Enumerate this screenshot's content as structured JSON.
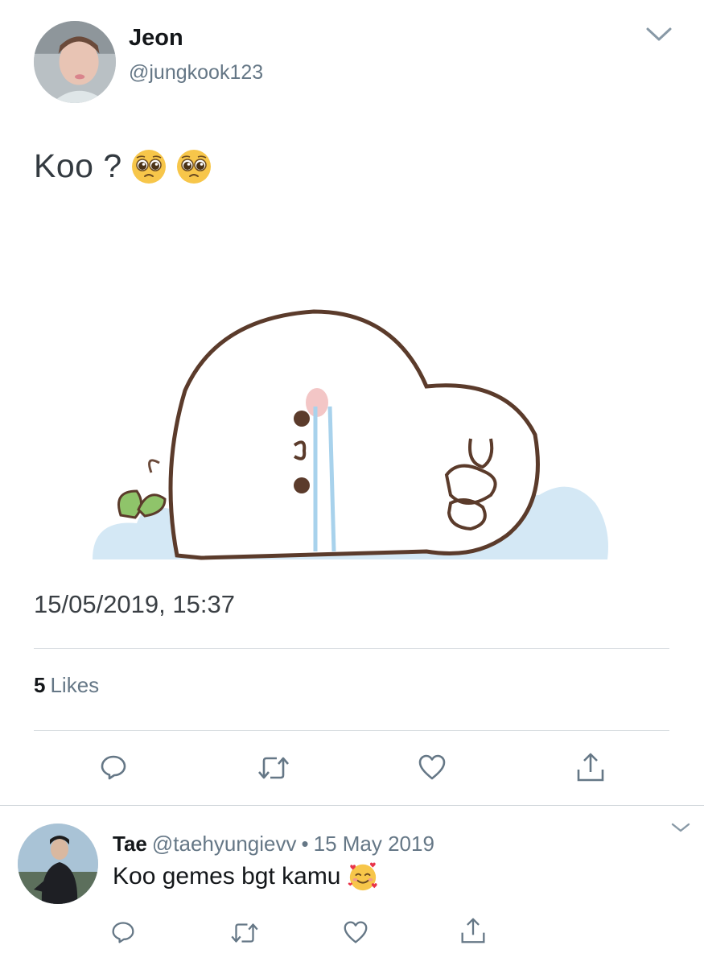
{
  "tweet": {
    "author_name": "Jeon",
    "author_handle": "@jungkook123",
    "text": "Koo ?",
    "emojis": [
      "pleading-face-emoji",
      "pleading-face-emoji"
    ],
    "timestamp": "15/05/2019, 15:37",
    "likes_count": "5",
    "likes_label": "Likes",
    "actions": [
      "reply-icon",
      "retweet-icon",
      "like-heart-icon",
      "share-icon"
    ]
  },
  "reply": {
    "author_name": "Tae",
    "author_handle": "@taehyungievv",
    "separator": "•",
    "date": "15 May 2019",
    "text": "Koo gemes bgt kamu",
    "emoji": "smiling-face-with-hearts-emoji",
    "actions": [
      "reply-icon",
      "retweet-icon",
      "like-heart-icon",
      "share-icon"
    ]
  },
  "colors": {
    "secondary_text": "#657786",
    "primary_text": "#14171a",
    "icon": "#657786",
    "divider": "#d8dde1",
    "cloud_blue": "#d4e8f5",
    "leaf_green": "#8fc46a"
  }
}
